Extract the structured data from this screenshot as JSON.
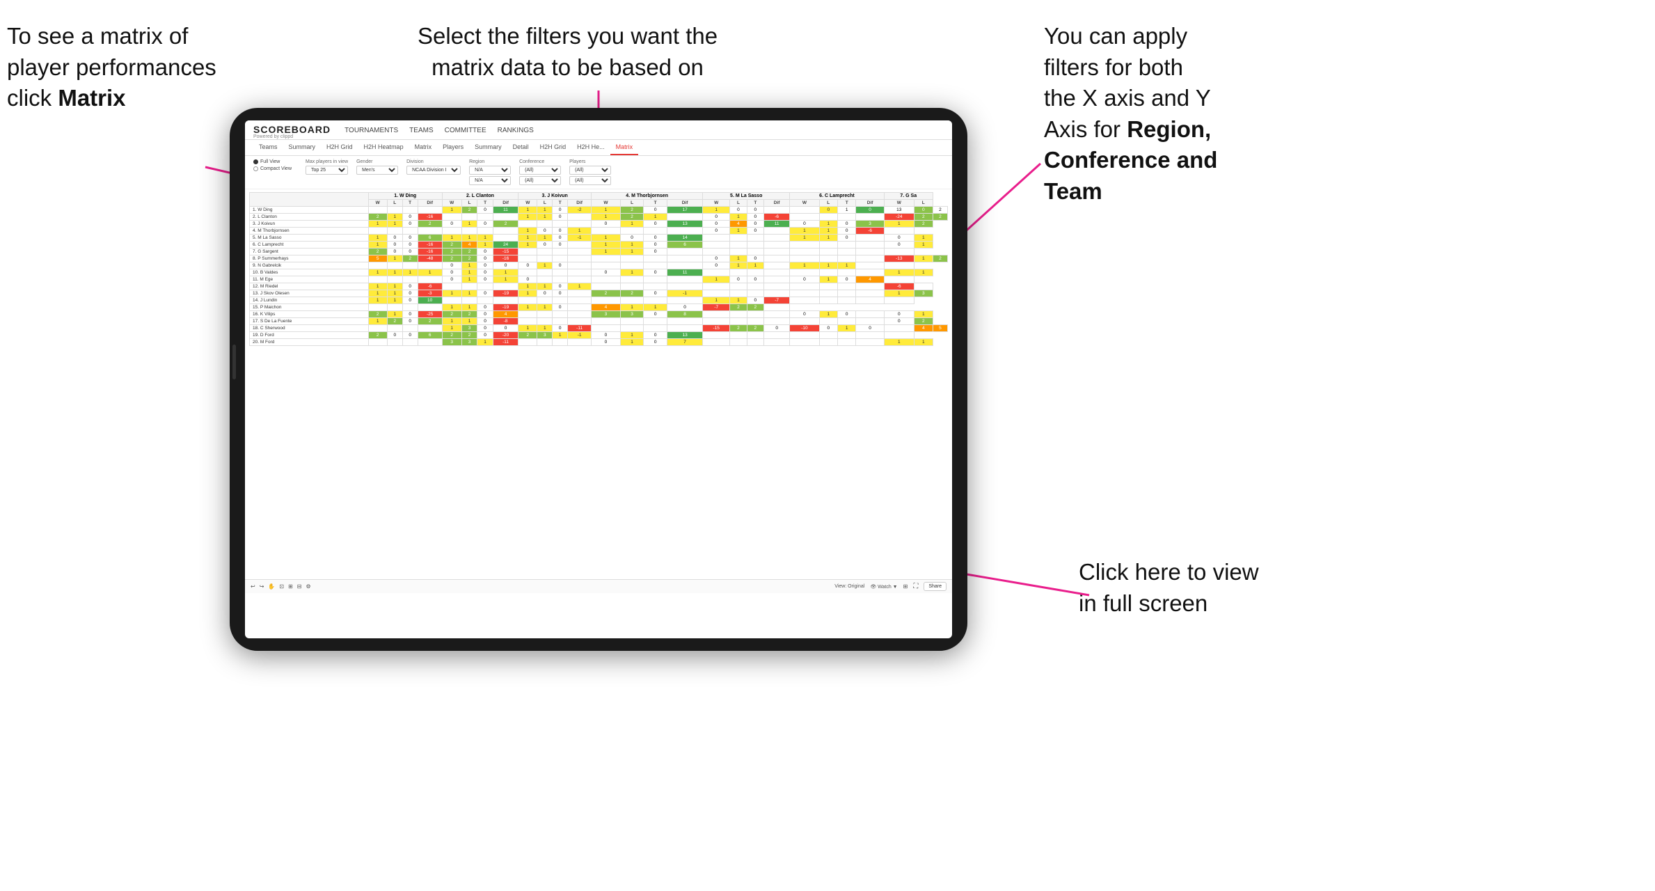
{
  "annotations": {
    "top_left": {
      "line1": "To see a matrix of",
      "line2": "player performances",
      "line3_normal": "click ",
      "line3_bold": "Matrix"
    },
    "top_center": {
      "line1": "Select the filters you want the",
      "line2": "matrix data to be based on"
    },
    "top_right": {
      "line1": "You  can apply",
      "line2": "filters for both",
      "line3": "the X axis and Y",
      "line4_normal": "Axis for ",
      "line4_bold": "Region,",
      "line5_bold": "Conference and",
      "line6_bold": "Team"
    },
    "bottom_right": {
      "line1": "Click here to view",
      "line2": "in full screen"
    }
  },
  "app": {
    "logo_main": "SCOREBOARD",
    "logo_sub": "Powered by clippd",
    "nav": [
      "TOURNAMENTS",
      "TEAMS",
      "COMMITTEE",
      "RANKINGS"
    ],
    "sub_tabs": [
      "Teams",
      "Summary",
      "H2H Grid",
      "H2H Heatmap",
      "Matrix",
      "Players",
      "Summary",
      "Detail",
      "H2H Grid",
      "H2H He...",
      "Matrix"
    ],
    "active_tab": "Matrix",
    "filters": {
      "view_options": [
        "Full View",
        "Compact View"
      ],
      "selected_view": "Full View",
      "max_players_label": "Max players in view",
      "max_players_value": "Top 25",
      "gender_label": "Gender",
      "gender_value": "Men's",
      "division_label": "Division",
      "division_value": "NCAA Division I",
      "region_label": "Region",
      "region_value": "N/A",
      "conference_label": "Conference",
      "conference_value1": "(All)",
      "conference_value2": "(All)",
      "players_label": "Players",
      "players_value1": "(All)",
      "players_value2": "(All)"
    },
    "matrix": {
      "col_headers": [
        "1. W Ding",
        "2. L Clanton",
        "3. J Koivun",
        "4. M Thorbjornsen",
        "5. M La Sasso",
        "6. C Lamprecht",
        "7. G Sa"
      ],
      "sub_headers": [
        "W",
        "L",
        "T",
        "Dif"
      ],
      "rows": [
        {
          "name": "1. W Ding",
          "cells": [
            "",
            "",
            "",
            "",
            "1",
            "2",
            "0",
            "11",
            "1",
            "1",
            "0",
            "-2",
            "1",
            "2",
            "0",
            "17",
            "1",
            "0",
            "0",
            "",
            "",
            "0",
            "1",
            "0",
            "13",
            "0",
            "2"
          ]
        },
        {
          "name": "2. L Clanton",
          "cells": [
            "2",
            "1",
            "0",
            "-16",
            "",
            "",
            "",
            "",
            "1",
            "1",
            "0",
            "",
            "1",
            "2",
            "1",
            "",
            "0",
            "1",
            "0",
            "-6",
            "",
            "",
            "",
            "",
            "-24",
            "2",
            "2"
          ]
        },
        {
          "name": "3. J Koivun",
          "cells": [
            "1",
            "1",
            "0",
            "2",
            "0",
            "1",
            "0",
            "2",
            "",
            "",
            "",
            "",
            "0",
            "1",
            "0",
            "13",
            "0",
            "4",
            "0",
            "11",
            "0",
            "1",
            "0",
            "3",
            "1",
            "2"
          ]
        },
        {
          "name": "4. M Thorbjornsen",
          "cells": [
            "",
            "",
            "",
            "",
            "",
            "",
            "",
            "",
            "1",
            "0",
            "0",
            "1",
            "",
            "",
            "",
            "",
            "0",
            "1",
            "0",
            "",
            "1",
            "1",
            "0",
            "-6",
            ""
          ]
        },
        {
          "name": "5. M La Sasso",
          "cells": [
            "1",
            "0",
            "0",
            "6",
            "1",
            "1",
            "1",
            "",
            "1",
            "1",
            "0",
            "-1",
            "1",
            "0",
            "0",
            "14",
            "",
            "",
            "",
            "",
            "1",
            "1",
            "0",
            "",
            "0",
            "1"
          ]
        },
        {
          "name": "6. C Lamprecht",
          "cells": [
            "1",
            "0",
            "0",
            "-16",
            "2",
            "4",
            "1",
            "24",
            "1",
            "0",
            "0",
            "",
            "1",
            "1",
            "0",
            "6",
            "",
            "",
            "",
            "",
            "",
            "",
            "",
            "",
            "0",
            "1"
          ]
        },
        {
          "name": "7. G Sargent",
          "cells": [
            "2",
            "0",
            "0",
            "-16",
            "2",
            "2",
            "0",
            "-15",
            "",
            "",
            "",
            "",
            "1",
            "1",
            "0",
            "",
            "",
            "",
            "",
            "",
            "",
            "",
            "",
            "",
            ""
          ]
        },
        {
          "name": "8. P Summerhays",
          "cells": [
            "5",
            "1",
            "2",
            "-48",
            "2",
            "2",
            "0",
            "-16",
            "",
            "",
            "",
            "",
            "",
            "",
            "",
            "",
            "0",
            "1",
            "0",
            "",
            "",
            "",
            "",
            "",
            "-13",
            "1",
            "2"
          ]
        },
        {
          "name": "9. N Gabrelcik",
          "cells": [
            "",
            "",
            "",
            "",
            "0",
            "1",
            "0",
            "0",
            "0",
            "1",
            "0",
            "",
            "",
            "",
            "",
            "",
            "0",
            "1",
            "1",
            "",
            "1",
            "1",
            "1",
            "",
            ""
          ]
        },
        {
          "name": "10. B Valdes",
          "cells": [
            "1",
            "1",
            "1",
            "1",
            "0",
            "1",
            "0",
            "1",
            "",
            "",
            "",
            "",
            "0",
            "1",
            "0",
            "11",
            "",
            "",
            "",
            "",
            "",
            "",
            "",
            "",
            "1",
            "1"
          ]
        },
        {
          "name": "11. M Ege",
          "cells": [
            "",
            "",
            "",
            "",
            "0",
            "1",
            "0",
            "1",
            "0",
            "",
            "",
            "",
            "",
            "",
            "",
            "",
            "1",
            "0",
            "0",
            "",
            "0",
            "1",
            "0",
            "4",
            ""
          ]
        },
        {
          "name": "12. M Riedel",
          "cells": [
            "1",
            "1",
            "0",
            "-6",
            "",
            "",
            "",
            "",
            "1",
            "1",
            "0",
            "1",
            "",
            "",
            "",
            "",
            "",
            "",
            "",
            "",
            "",
            "",
            "",
            "",
            "-6",
            ""
          ]
        },
        {
          "name": "13. J Skov Olesen",
          "cells": [
            "1",
            "1",
            "0",
            "-3",
            "1",
            "1",
            "0",
            "-19",
            "1",
            "0",
            "0",
            "",
            "2",
            "2",
            "0",
            "-1",
            "",
            "",
            "",
            "",
            "",
            "",
            "",
            "",
            "1",
            "3"
          ]
        },
        {
          "name": "14. J Lundin",
          "cells": [
            "1",
            "1",
            "0",
            "10",
            "",
            "",
            "",
            "",
            "",
            "",
            "",
            "",
            "",
            "",
            "",
            "",
            "1",
            "1",
            "0",
            "-7",
            "",
            "",
            "",
            "",
            ""
          ]
        },
        {
          "name": "15. P Maichon",
          "cells": [
            "",
            "",
            "",
            "",
            "1",
            "1",
            "0",
            "-19",
            "1",
            "1",
            "0",
            "",
            "4",
            "1",
            "1",
            "0",
            "-7",
            "2",
            "2",
            ""
          ]
        },
        {
          "name": "16. K Vilips",
          "cells": [
            "2",
            "1",
            "0",
            "-25",
            "2",
            "2",
            "0",
            "4",
            "",
            "",
            "",
            "",
            "3",
            "3",
            "0",
            "8",
            "",
            "",
            "",
            "",
            "0",
            "1",
            "0",
            "",
            "0",
            "1"
          ]
        },
        {
          "name": "17. S De La Fuente",
          "cells": [
            "1",
            "2",
            "0",
            "2",
            "1",
            "1",
            "0",
            "-8",
            "",
            "",
            "",
            "",
            "",
            "",
            "",
            "",
            "",
            "",
            "",
            "",
            "",
            "",
            "",
            "",
            "0",
            "2"
          ]
        },
        {
          "name": "18. C Sherwood",
          "cells": [
            "",
            "",
            "",
            "",
            "1",
            "3",
            "0",
            "0",
            "1",
            "1",
            "0",
            "-11",
            "",
            "",
            "",
            "",
            "-15",
            "2",
            "2",
            "0",
            "-10",
            "0",
            "1",
            "0",
            "",
            "4",
            "5"
          ]
        },
        {
          "name": "19. D Ford",
          "cells": [
            "2",
            "0",
            "0",
            "6",
            "2",
            "2",
            "0",
            "-20",
            "2",
            "3",
            "1",
            "-1",
            "0",
            "1",
            "0",
            "13",
            "",
            "",
            "",
            "",
            "",
            "",
            "",
            "",
            ""
          ]
        },
        {
          "name": "20. M Ford",
          "cells": [
            "",
            "",
            "",
            "",
            "3",
            "3",
            "1",
            "-11",
            "",
            "",
            "",
            "",
            "0",
            "1",
            "0",
            "7",
            "",
            "",
            "",
            "",
            "",
            "",
            "",
            "",
            "1",
            "1"
          ]
        }
      ]
    },
    "bottom_bar": {
      "left_icons": [
        "undo",
        "redo",
        "pan",
        "zoom-fit",
        "zoom-in",
        "zoom-out",
        "settings"
      ],
      "view_label": "View: Original",
      "watch_label": "Watch",
      "share_label": "Share"
    }
  }
}
